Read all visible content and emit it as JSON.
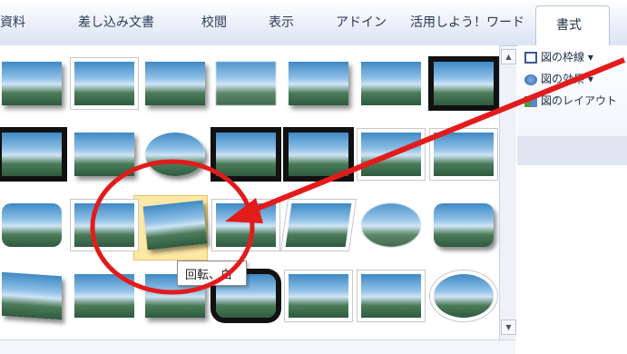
{
  "tabs": [
    {
      "label": "資料"
    },
    {
      "label": "差し込み文書"
    },
    {
      "label": "校閲"
    },
    {
      "label": "表示"
    },
    {
      "label": "アドイン"
    },
    {
      "label": "活用しよう！ワード"
    },
    {
      "label": "書式"
    }
  ],
  "active_tab": "書式",
  "right_group": {
    "border_label": "図の枠線 ▾",
    "effects_label": "図の効果 ▾",
    "layout_label": "図のレイアウト"
  },
  "tooltip": "回転、白",
  "colors": {
    "annotation_red": "#e21b1b",
    "selection_fill": "#fde8a4"
  }
}
